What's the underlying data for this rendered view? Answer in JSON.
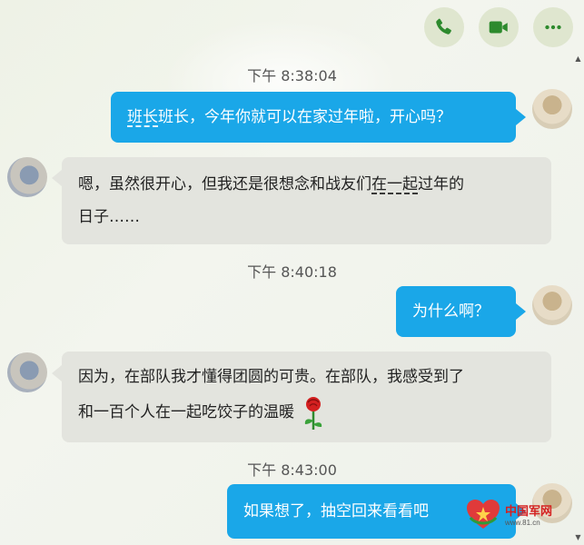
{
  "toolbar": {
    "phone_icon": "phone-icon",
    "video_icon": "video-icon",
    "more_icon": "more-icon",
    "accent": "#2d8a2d"
  },
  "messages": [
    {
      "time": "下午 8:38:04"
    },
    {
      "side": "out",
      "text_underlined": "班长",
      "text_rest": "班长，今年你就可以在家过年啦，开心吗？"
    },
    {
      "side": "in",
      "line1_a": "嗯，虽然很开心，但我还是很想念和战友们",
      "line1_u": "在一起",
      "line1_b": "过年的",
      "line2": "日子……"
    },
    {
      "time": "下午 8:40:18"
    },
    {
      "side": "out",
      "text": "为什么啊？"
    },
    {
      "side": "in",
      "line1": "因为，在部队我才懂得团圆的可贵。在部队，我感受到了",
      "line2": "和一百个人在一起吃饺子的温暖"
    },
    {
      "time": "下午 8:43:00"
    },
    {
      "side": "out",
      "text": "如果想了，抽空回来看看吧"
    }
  ],
  "watermark": {
    "title": "中国军网",
    "url": "www.81.cn"
  },
  "colors": {
    "bubble_out": "#1aa7e8",
    "bubble_in": "#e3e4de",
    "button_bg": "#dfe6cf"
  }
}
